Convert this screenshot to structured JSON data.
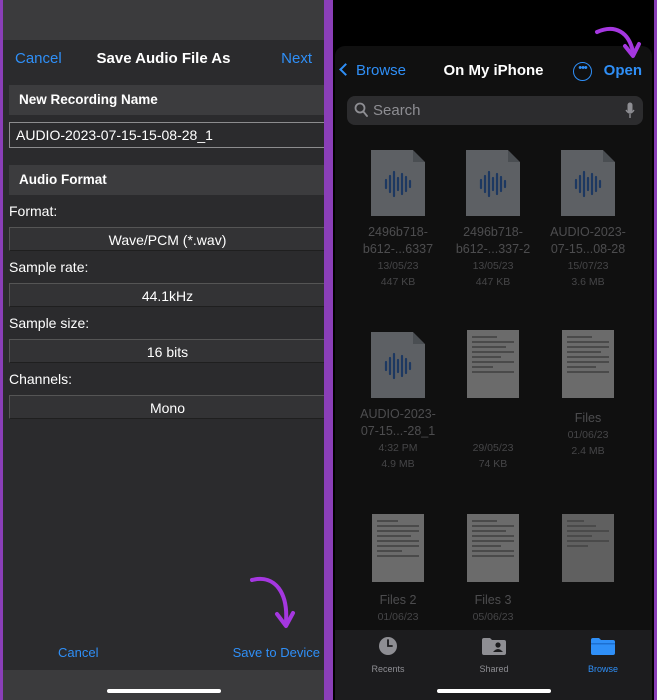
{
  "left": {
    "nav": {
      "cancel": "Cancel",
      "title": "Save Audio File As",
      "next": "Next"
    },
    "recording_section": "New Recording Name",
    "recording_name": "AUDIO-2023-07-15-15-08-28_1",
    "format_section": "Audio Format",
    "fields": [
      {
        "label": "Format:",
        "value": "Wave/PCM (*.wav)"
      },
      {
        "label": "Sample rate:",
        "value": "44.1kHz"
      },
      {
        "label": "Sample size:",
        "value": "16 bits"
      },
      {
        "label": "Channels:",
        "value": "Mono"
      }
    ],
    "footer": {
      "cancel": "Cancel",
      "save": "Save to Device"
    }
  },
  "right": {
    "nav": {
      "back": "Browse",
      "title": "On My iPhone",
      "more_icon": "ellipsis-circle-icon",
      "open": "Open"
    },
    "search": {
      "placeholder": "Search"
    },
    "files": [
      {
        "kind": "audio",
        "name1": "2496b718-",
        "name2": "b612-...6337",
        "date": "13/05/23",
        "size": "447 KB"
      },
      {
        "kind": "audio",
        "name1": "2496b718-",
        "name2": "b612-...337-2",
        "date": "13/05/23",
        "size": "447 KB"
      },
      {
        "kind": "audio",
        "name1": "AUDIO-2023-",
        "name2": "07-15...08-28",
        "date": "15/07/23",
        "size": "3.6 MB"
      },
      {
        "kind": "audio",
        "name1": "AUDIO-2023-",
        "name2": "07-15...-28_1",
        "date": "4:32 PM",
        "size": "4.9 MB"
      },
      {
        "kind": "doc",
        "name1": "",
        "name2": "",
        "date": "29/05/23",
        "size": "74 KB"
      },
      {
        "kind": "doc",
        "name1": "Files",
        "name2": "",
        "date": "01/06/23",
        "size": "2.4 MB"
      },
      {
        "kind": "doc",
        "name1": "Files 2",
        "name2": "",
        "date": "01/06/23",
        "size": ""
      },
      {
        "kind": "doc",
        "name1": "Files 3",
        "name2": "",
        "date": "05/06/23",
        "size": ""
      },
      {
        "kind": "doc",
        "name1": "",
        "name2": "",
        "date": "",
        "size": ""
      }
    ],
    "tabs": [
      {
        "label": "Recents",
        "icon": "clock-icon"
      },
      {
        "label": "Shared",
        "icon": "shared-folder-icon"
      },
      {
        "label": "Browse",
        "icon": "folder-icon",
        "active": true
      }
    ]
  },
  "colors": {
    "accent": "#2f8ff7",
    "arrow": "#a537e0",
    "border": "#8a3fb8"
  }
}
